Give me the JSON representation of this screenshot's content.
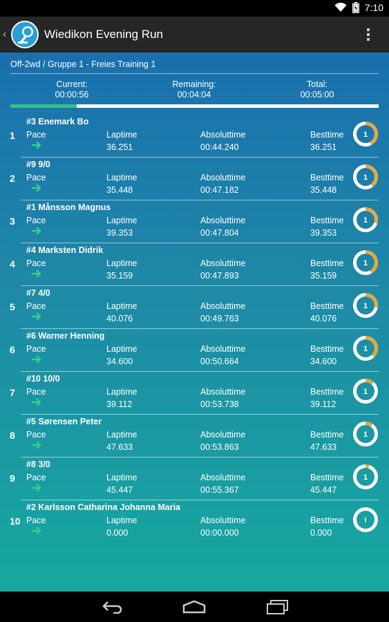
{
  "status": {
    "time": "7:10"
  },
  "app": {
    "title": "Wiedikon Evening Run"
  },
  "session": {
    "label": "Off-2wd / Gruppe 1 - Freies Training 1"
  },
  "timers": {
    "current_label": "Current:",
    "current_value": "00:00:56",
    "remaining_label": "Remaining:",
    "remaining_value": "00:04:04",
    "total_label": "Total:",
    "total_value": "00:05:00"
  },
  "progress": 0.18,
  "labels": {
    "pace": "Pace",
    "laptime": "Laptime",
    "absolute": "Absoluttime",
    "best": "Besttime"
  },
  "colors": {
    "ring_progress": "#e6a93a",
    "ring_base": "#ffffff",
    "arrow": "#35d08a"
  },
  "rows": [
    {
      "pos": "1",
      "name": "#3 Enemark Bo",
      "laptime": "36.251",
      "absolute": "00:44.240",
      "best": "36.251",
      "laps": "1",
      "ring": 0.42
    },
    {
      "pos": "2",
      "name": "#9 9/0",
      "laptime": "35.448",
      "absolute": "00:47.182",
      "best": "35.448",
      "laps": "1",
      "ring": 0.4
    },
    {
      "pos": "3",
      "name": "#1 Månsson Magnus",
      "laptime": "39.353",
      "absolute": "00:47.804",
      "best": "39.353",
      "laps": "1",
      "ring": 0.3
    },
    {
      "pos": "4",
      "name": "#4 Marksten Didrik",
      "laptime": "35.159",
      "absolute": "00:47.893",
      "best": "35.159",
      "laps": "1",
      "ring": 0.42
    },
    {
      "pos": "5",
      "name": "#7 4/0",
      "laptime": "40.076",
      "absolute": "00:49.763",
      "best": "40.076",
      "laps": "1",
      "ring": 0.28
    },
    {
      "pos": "6",
      "name": "#6 Warner Henning",
      "laptime": "34.600",
      "absolute": "00:50.664",
      "best": "34.600",
      "laps": "1",
      "ring": 0.38
    },
    {
      "pos": "7",
      "name": "#10 10/0",
      "laptime": "39.112",
      "absolute": "00:53.738",
      "best": "39.112",
      "laps": "1",
      "ring": 0.12
    },
    {
      "pos": "8",
      "name": "#5 Sørensen Peter",
      "laptime": "47.633",
      "absolute": "00:53.863",
      "best": "47.633",
      "laps": "1",
      "ring": 0.1
    },
    {
      "pos": "9",
      "name": "#8 3/0",
      "laptime": "45.447",
      "absolute": "00:55.367",
      "best": "45.447",
      "laps": "1",
      "ring": 0.05
    },
    {
      "pos": "10",
      "name": "#2 Karlsson Catharina Johanna Maria",
      "laptime": "0.000",
      "absolute": "00:00.000",
      "best": "0.000",
      "laps": "!",
      "ring": 0.0
    }
  ]
}
